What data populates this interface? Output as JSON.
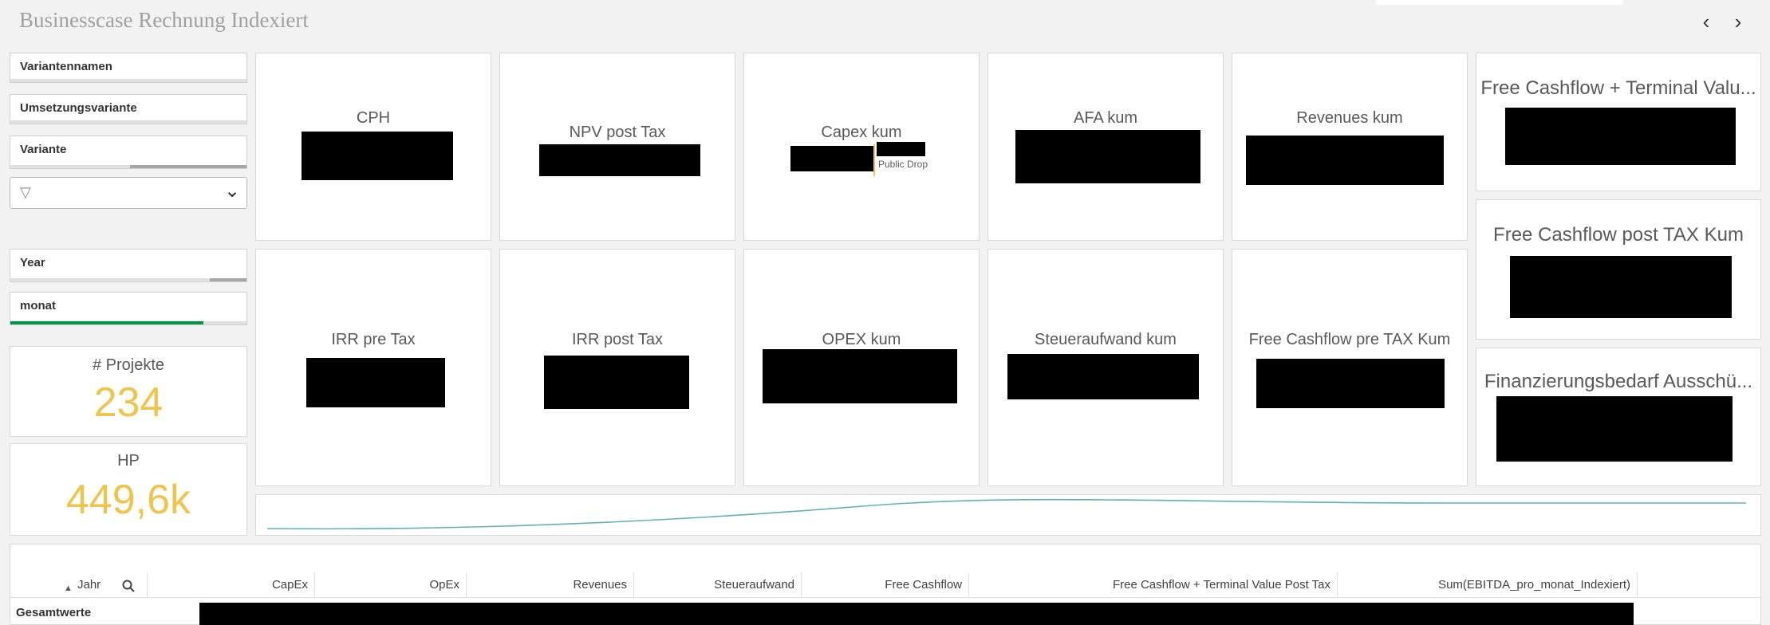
{
  "app": {
    "title": "Businesscase Rechnung Indexiert"
  },
  "nav": {
    "prev": "‹",
    "next": "›"
  },
  "filters": {
    "variantennamen": "Variantennamen",
    "umsetzungsvariante": "Umsetzungsvariante",
    "variante": "Variante",
    "year": "Year",
    "monat": "monat",
    "dropdown_filter_icon": "▽",
    "dropdown_chevron": "⌄"
  },
  "kpis": {
    "projekte": {
      "label": "# Projekte",
      "value": "234"
    },
    "hp": {
      "label": "HP",
      "value": "449,6k"
    }
  },
  "cards": {
    "cph": "CPH",
    "npv": "NPV post Tax",
    "capex": "Capex kum",
    "capex_annotation": "Public Drop",
    "afa": "AFA kum",
    "revenues": "Revenues kum",
    "irr_pre": "IRR pre Tax",
    "irr_post": "IRR post Tax",
    "opex": "OPEX kum",
    "steuer": "Steueraufwand kum",
    "fcf_pre": "Free Cashflow pre TAX Kum",
    "fcf_terminal": "Free Cashflow + Terminal Valu...",
    "fcf_post": "Free Cashflow post TAX Kum",
    "finanz": "Finanzierungsbedarf Ausschü..."
  },
  "colors": {
    "accent_kpi": "#f0c34a",
    "selection_green": "#009845",
    "sparkline": "#5fb3b3"
  },
  "table": {
    "headers": {
      "jahr": "Jahr",
      "capex": "CapEx",
      "opex": "OpEx",
      "revenues": "Revenues",
      "steuer": "Steueraufwand",
      "fcf": "Free Cashflow",
      "fcf_tv": "Free Cashflow + Terminal Value Post Tax",
      "ebitda": "Sum(EBITDA_pro_monat_Indexiert)"
    },
    "sort_icon": "▲",
    "search_icon": "search-icon",
    "total_row_label": "Gesamtwerte"
  }
}
